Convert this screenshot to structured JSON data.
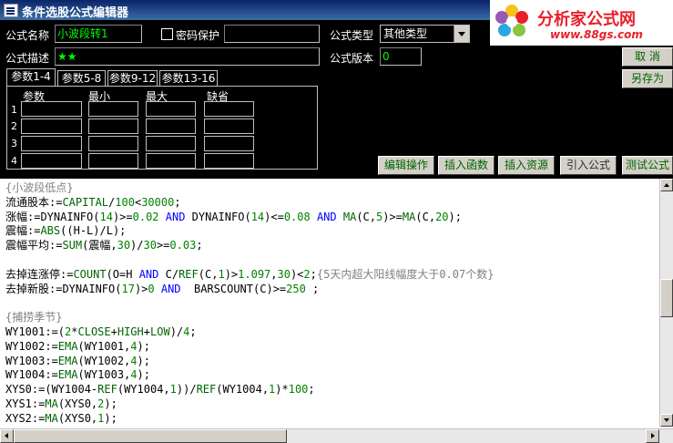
{
  "window": {
    "title": "条件选股公式编辑器"
  },
  "watermark": {
    "name": "分析家公式网",
    "url": "www.88gs.com"
  },
  "form": {
    "formula_name_label": "公式名称",
    "formula_name_value": "小波段转1",
    "password_label": "密码保护",
    "password_value": "",
    "formula_type_label": "公式类型",
    "formula_type_value": "其他类型",
    "description_label": "公式描述",
    "description_value": "★★",
    "version_label": "公式版本",
    "version_value": "0"
  },
  "buttons": {
    "cancel": "取  消",
    "save_as": "另存为",
    "edit_operation": "编辑操作",
    "insert_function": "插入函数",
    "insert_resource": "插入资源",
    "import_formula": "引入公式",
    "test_formula": "测试公式"
  },
  "tabs": [
    {
      "label": "参数1-4"
    },
    {
      "label": "参数5-8"
    },
    {
      "label": "参数9-12"
    },
    {
      "label": "参数13-16"
    }
  ],
  "param_table": {
    "headers": [
      "参数",
      "最小",
      "最大",
      "缺省"
    ],
    "rows": [
      "1",
      "2",
      "3",
      "4"
    ]
  },
  "code": {
    "l1": "{小波段低点}",
    "l2a": "流通股本:=",
    "l2b": "CAPITAL",
    "l2c": "/",
    "l2d": "100",
    "l2e": "<",
    "l2f": "30000",
    "l2g": ";",
    "l3a": "涨幅:=",
    "l3b": "DYNAINFO",
    "l3c": "(",
    "l3d": "14",
    "l3e": ")>=",
    "l3f": "0.02",
    "l3g": " AND ",
    "l3h": "DYNAINFO",
    "l3i": "(",
    "l3j": "14",
    "l3k": ")<=",
    "l3l": "0.08",
    "l3m": " AND ",
    "l3n": "MA",
    "l3o": "(C,",
    "l3p": "5",
    "l3q": ")>=",
    "l3r": "MA",
    "l3s": "(C,",
    "l3t": "20",
    "l3u": ");",
    "l4a": "震幅:=",
    "l4b": "ABS",
    "l4c": "((H-L)/L);",
    "l5a": "震幅平均:=",
    "l5b": "SUM",
    "l5c": "(震幅,",
    "l5d": "30",
    "l5e": ")/",
    "l5f": "30",
    "l5g": ">=",
    "l5h": "0.03",
    "l5i": ";",
    "l6": "",
    "l7a": "去掉连涨停:=",
    "l7b": "COUNT",
    "l7c": "(O=H ",
    "l7d": "AND",
    "l7e": " C/",
    "l7f": "REF",
    "l7g": "(C,",
    "l7h": "1",
    "l7i": ")>",
    "l7j": "1.097",
    "l7k": ",",
    "l7l": "30",
    "l7m": ")<",
    "l7n": "2",
    "l7o": ";",
    "l7p": "{5天内超大阳线幅度大于0.07个数}",
    "l8a": "去掉新股:=",
    "l8b": "DYNAINFO",
    "l8c": "(",
    "l8d": "17",
    "l8e": ")>",
    "l8f": "0",
    "l8g": " AND  ",
    "l8h": "BARSCOUNT",
    "l8i": "(C)>=",
    "l8j": "250",
    "l8k": " ;",
    "l9": "",
    "l10": "{捕捞季节}",
    "l11a": "WY1001:=(",
    "l11b": "2",
    "l11c": "*",
    "l11d": "CLOSE",
    "l11e": "+",
    "l11f": "HIGH",
    "l11g": "+",
    "l11h": "LOW",
    "l11i": ")/",
    "l11j": "4",
    "l11k": ";",
    "l12a": "WY1002:=",
    "l12b": "EMA",
    "l12c": "(WY1001,",
    "l12d": "4",
    "l12e": ");",
    "l13a": "WY1003:=",
    "l13b": "EMA",
    "l13c": "(WY1002,",
    "l13d": "4",
    "l13e": ");",
    "l14a": "WY1004:=",
    "l14b": "EMA",
    "l14c": "(WY1003,",
    "l14d": "4",
    "l14e": ");",
    "l15a": "XYS0:=(WY1004-",
    "l15b": "REF",
    "l15c": "(WY1004,",
    "l15d": "1",
    "l15e": "))/",
    "l15f": "REF",
    "l15g": "(WY1004,",
    "l15h": "1",
    "l15i": ")*",
    "l15j": "100",
    "l15k": ";",
    "l16a": "XYS1:=",
    "l16b": "MA",
    "l16c": "(XYS0,",
    "l16d": "2",
    "l16e": ");",
    "l17a": "XYS2:=",
    "l17b": "MA",
    "l17c": "(XYS0,",
    "l17d": "1",
    "l17e": ");"
  }
}
